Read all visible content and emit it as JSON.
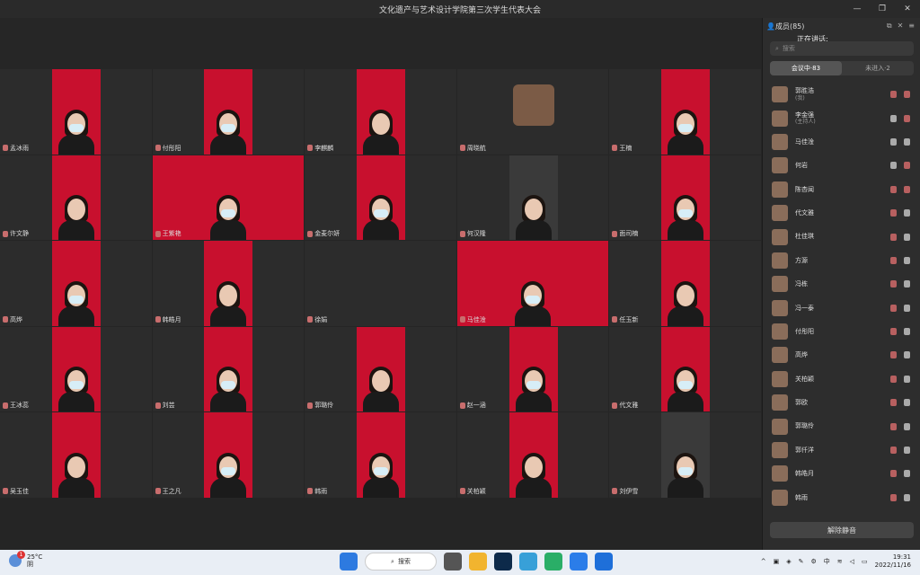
{
  "window": {
    "title": "文化遗产与艺术设计学院第三次学生代表大会"
  },
  "tiles": [
    {
      "name": "孟冰雨"
    },
    {
      "name": "付彤阳"
    },
    {
      "name": "李麒麟"
    },
    {
      "name": "周晓航"
    },
    {
      "name": "王楠"
    },
    {
      "name": "许文静"
    },
    {
      "name": "王紫艳"
    },
    {
      "name": "金麦尔妍"
    },
    {
      "name": "何汉隆"
    },
    {
      "name": "面司楠"
    },
    {
      "name": "高烨"
    },
    {
      "name": "韩皓月"
    },
    {
      "name": "徐娟"
    },
    {
      "name": "马佳淦"
    },
    {
      "name": "任玉新"
    },
    {
      "name": "王冰蕊"
    },
    {
      "name": "刘芸"
    },
    {
      "name": "郭璐伶"
    },
    {
      "name": "赵一涵"
    },
    {
      "name": "代文雅"
    },
    {
      "name": "吴玉佳"
    },
    {
      "name": "王之凡"
    },
    {
      "name": "韩雨"
    },
    {
      "name": "关柏颖"
    },
    {
      "name": "刘伊雪"
    }
  ],
  "banner_text": "文化遗产与艺术设计学院第三次学生代表大会",
  "sidebar": {
    "header": "成员(85)",
    "speaking_label": "正在讲话:",
    "search_placeholder": "搜索",
    "tabs": [
      "会议中·83",
      "未进入·2"
    ],
    "members": [
      {
        "name": "郭胜浩",
        "sub": "(我)",
        "mic": "off",
        "cam": "off"
      },
      {
        "name": "李金强",
        "sub": "(主持人)",
        "mic": "on",
        "cam": "off"
      },
      {
        "name": "马佳淦",
        "sub": "",
        "mic": "on",
        "cam": "on"
      },
      {
        "name": "何岩",
        "sub": "",
        "mic": "on",
        "cam": "off"
      },
      {
        "name": "陈杏闻",
        "sub": "",
        "mic": "off",
        "cam": "off"
      },
      {
        "name": "代文雅",
        "sub": "",
        "mic": "off",
        "cam": "on"
      },
      {
        "name": "杜佳琪",
        "sub": "",
        "mic": "off",
        "cam": "on"
      },
      {
        "name": "方源",
        "sub": "",
        "mic": "off",
        "cam": "on"
      },
      {
        "name": "冯栋",
        "sub": "",
        "mic": "off",
        "cam": "on"
      },
      {
        "name": "冯一泰",
        "sub": "",
        "mic": "off",
        "cam": "on"
      },
      {
        "name": "付彤阳",
        "sub": "",
        "mic": "off",
        "cam": "on"
      },
      {
        "name": "高烨",
        "sub": "",
        "mic": "off",
        "cam": "on"
      },
      {
        "name": "关柏颖",
        "sub": "",
        "mic": "off",
        "cam": "on"
      },
      {
        "name": "郭欧",
        "sub": "",
        "mic": "off",
        "cam": "on"
      },
      {
        "name": "郭璐伶",
        "sub": "",
        "mic": "off",
        "cam": "on"
      },
      {
        "name": "郭仟洋",
        "sub": "",
        "mic": "off",
        "cam": "on"
      },
      {
        "name": "韩皓月",
        "sub": "",
        "mic": "off",
        "cam": "on"
      },
      {
        "name": "韩雨",
        "sub": "",
        "mic": "off",
        "cam": "on"
      }
    ],
    "unmute_label": "解除静音"
  },
  "taskbar": {
    "temp": "25°C",
    "weather": "阴",
    "badge": "1",
    "search_label": "搜索",
    "lang": "中",
    "time": "19:31",
    "date": "2022/11/16"
  }
}
